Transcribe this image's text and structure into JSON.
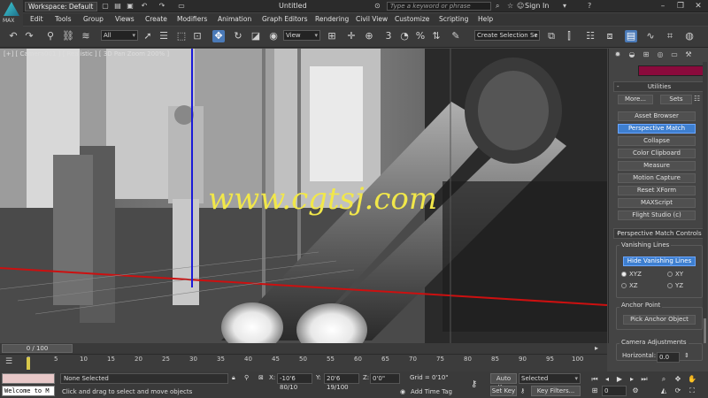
{
  "app": {
    "logo_label": "MAX",
    "workspace": "Workspace: Default",
    "doc_title": "Untitled",
    "search_placeholder": "Type a keyword or phrase",
    "sign_in": "Sign In"
  },
  "menu": [
    "Edit",
    "Tools",
    "Group",
    "Views",
    "Create",
    "Modifiers",
    "Animation",
    "Graph Editors",
    "Rendering",
    "Civil View",
    "Customize",
    "Scripting",
    "Help"
  ],
  "toolbar": {
    "filter": "All",
    "ref_coord": "View",
    "selection_set": "Create Selection Se"
  },
  "viewport": {
    "label": "[+] [ Camera001 ] [ Realistic ] [ 3D Pan Zoom 200% ]",
    "watermark": "www.cgtsj.com"
  },
  "panel": {
    "utilities_title": "Utilities",
    "more_button": "More...",
    "sets_button": "Sets",
    "utilities": [
      "Asset Browser",
      "Perspective Match",
      "Collapse",
      "Color Clipboard",
      "Measure",
      "Motion Capture",
      "Reset XForm",
      "MAXScript",
      "Flight Studio (c)"
    ],
    "active_utility": "Perspective Match",
    "pm_title": "Perspective Match Controls",
    "vanishing_lines": "Vanishing Lines",
    "hide_vanishing_lines": "Hide Vanishing Lines",
    "axes": [
      "XYZ",
      "XY",
      "XZ",
      "YZ"
    ],
    "selected_axis": "XYZ",
    "anchor_point": "Anchor Point",
    "pick_anchor": "Pick Anchor Object",
    "camera_adjustments": "Camera Adjustments",
    "horizontal_label": "Horizontal:",
    "horizontal_value": "0.0",
    "collapse_sign": "-",
    "colors": {
      "swatch": "#8a0a3c",
      "active": "#3e7fd0"
    }
  },
  "timeline": {
    "slider": "0 / 100",
    "ticks": [
      "0",
      "5",
      "10",
      "15",
      "20",
      "25",
      "30",
      "35",
      "40",
      "45",
      "50",
      "55",
      "60",
      "65",
      "70",
      "75",
      "80",
      "85",
      "90",
      "95",
      "100"
    ]
  },
  "status": {
    "maxscript": "Welcome to M",
    "selection": "None Selected",
    "prompt": "Click and drag to select and move objects",
    "x_label": "X:",
    "x_value": "-10'6 80/10",
    "y_label": "Y:",
    "y_value": "20'6 19/100",
    "z_label": "Z:",
    "z_value": "0'0\"",
    "grid": "Grid = 0'10\"",
    "add_time_tag": "Add Time Tag",
    "auto_key": "Auto Key",
    "set_key": "Set Key",
    "key_mode": "Selected",
    "key_filters": "Key Filters...",
    "frame": "0"
  }
}
